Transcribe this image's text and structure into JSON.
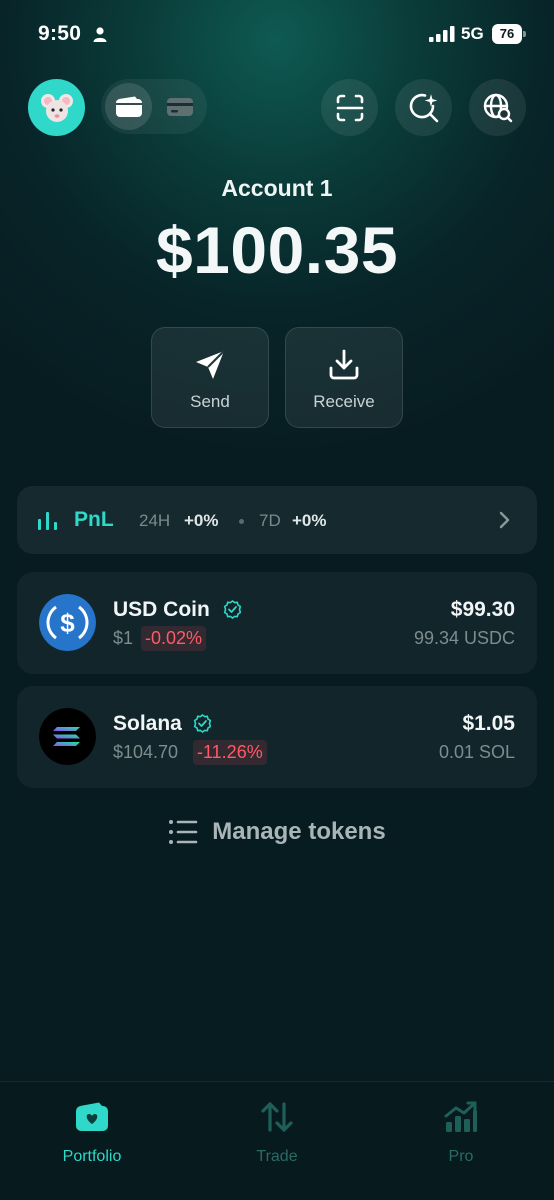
{
  "status_bar": {
    "time": "9:50",
    "network": "5G",
    "battery": "76"
  },
  "header": {
    "avatar_icon": "mouse-face-icon",
    "segment": [
      "wallet-icon",
      "card-icon"
    ],
    "buttons": [
      "scan-icon",
      "search-sparkle-icon",
      "globe-search-icon"
    ]
  },
  "account": {
    "name": "Account 1",
    "balance": "$100.35"
  },
  "actions": {
    "send": "Send",
    "receive": "Receive"
  },
  "pnl": {
    "title": "PnL",
    "label_24h": "24H",
    "value_24h": "+0%",
    "label_7d": "7D",
    "value_7d": "+0%"
  },
  "tokens": [
    {
      "name": "USD Coin",
      "price": "$1",
      "change": "-0.02%",
      "value": "$99.30",
      "amount": "99.34 USDC"
    },
    {
      "name": "Solana",
      "price": "$104.70",
      "change": "-11.26%",
      "value": "$1.05",
      "amount": "0.01 SOL"
    }
  ],
  "manage_tokens": "Manage tokens",
  "nav": {
    "portfolio": "Portfolio",
    "trade": "Trade",
    "pro": "Pro"
  },
  "colors": {
    "accent": "#2fd8c8",
    "negative": "#ff5a66",
    "background": "#071c21"
  }
}
